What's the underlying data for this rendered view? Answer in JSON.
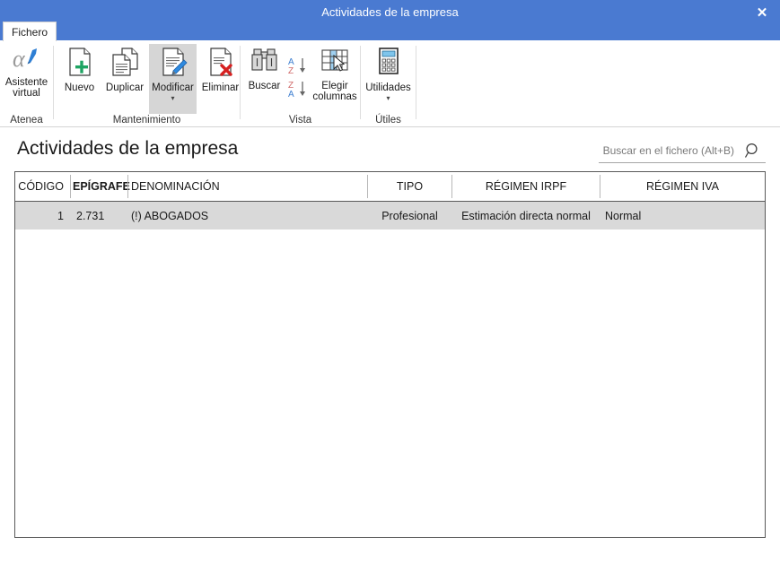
{
  "window": {
    "title": "Actividades de la empresa",
    "close_label": "✕",
    "close_icon": "close-icon",
    "titlebar_color": "#4a7ad1"
  },
  "tabs": [
    {
      "label": "Fichero",
      "name": "tab-fichero",
      "active": true
    }
  ],
  "ribbon": {
    "groups": [
      {
        "name": "atenea",
        "label": "Atenea",
        "buttons": [
          {
            "name": "asistente-virtual-button",
            "label": "Asistente\nvirtual",
            "label_line1": "Asistente",
            "label_line2": "virtual",
            "icon": "alpha-pen-icon",
            "has_caret": false
          }
        ]
      },
      {
        "name": "mantenimiento",
        "label": "Mantenimiento",
        "buttons": [
          {
            "name": "nuevo-button",
            "label": "Nuevo",
            "icon": "document-plus-icon",
            "has_caret": false
          },
          {
            "name": "duplicar-button",
            "label": "Duplicar",
            "icon": "document-copy-icon",
            "has_caret": false
          },
          {
            "name": "modificar-button",
            "label": "Modificar",
            "icon": "document-pencil-icon",
            "has_caret": true,
            "active": true
          },
          {
            "name": "eliminar-button",
            "label": "Eliminar",
            "icon": "document-delete-icon",
            "has_caret": false
          }
        ]
      },
      {
        "name": "vista",
        "label": "Vista",
        "buttons": [
          {
            "name": "buscar-button",
            "label": "Buscar",
            "icon": "binoculars-icon",
            "has_caret": false
          },
          {
            "name": "sort-ascending-button",
            "label": "",
            "icon": "sort-az-icon",
            "has_caret": false
          },
          {
            "name": "sort-descending-button",
            "label": "",
            "icon": "sort-za-icon",
            "has_caret": false
          },
          {
            "name": "elegir-columnas-button",
            "label": "Elegir\ncolumnas",
            "label_line1": "Elegir",
            "label_line2": "columnas",
            "icon": "table-columns-icon",
            "has_caret": false
          }
        ]
      },
      {
        "name": "utiles",
        "label": "Útiles",
        "buttons": [
          {
            "name": "utilidades-button",
            "label": "Utilidades",
            "icon": "calculator-icon",
            "has_caret": true
          }
        ]
      }
    ]
  },
  "main": {
    "page_title": "Actividades de la empresa",
    "search": {
      "placeholder": "Buscar en el fichero (Alt+B)",
      "value": "",
      "icon": "search-icon"
    },
    "table": {
      "columns": [
        {
          "key": "codigo",
          "label": "CÓDIGO",
          "align": "right",
          "bold": false
        },
        {
          "key": "epigrafe",
          "label": "EPÍGRAFE",
          "align": "left",
          "bold": true
        },
        {
          "key": "denominacion",
          "label": "DENOMINACIÓN",
          "align": "left",
          "bold": false
        },
        {
          "key": "tipo",
          "label": "TIPO",
          "align": "center",
          "bold": false
        },
        {
          "key": "irpf",
          "label": "RÉGIMEN IRPF",
          "align": "center",
          "bold": false
        },
        {
          "key": "iva",
          "label": "RÉGIMEN IVA",
          "align": "center",
          "bold": false
        }
      ],
      "rows": [
        {
          "codigo": "1",
          "epigrafe": "2.731",
          "denominacion": "(!) ABOGADOS",
          "tipo": "Profesional",
          "irpf": "Estimación directa normal",
          "iva": "Normal",
          "selected": true
        }
      ]
    }
  },
  "colors": {
    "accent": "#4a7ad1",
    "row_selected": "#d9d9d9",
    "ribbon_hover": "#d6d6d6",
    "border": "#595959"
  }
}
